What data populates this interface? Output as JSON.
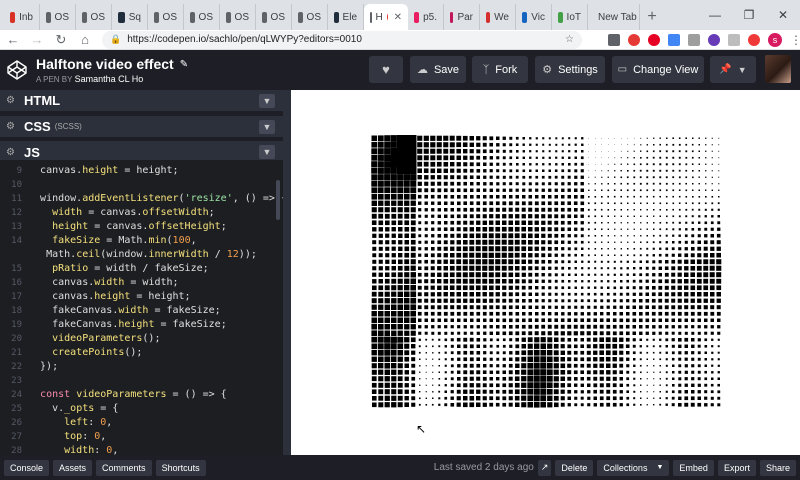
{
  "browser": {
    "tabs": [
      {
        "label": "Inb",
        "icon": "gmail-icon",
        "color": "#d93025"
      },
      {
        "label": "OS",
        "icon": "doc-icon",
        "color": "#5f6368"
      },
      {
        "label": "OS",
        "icon": "doc-icon",
        "color": "#5f6368"
      },
      {
        "label": "Sq",
        "icon": "tuts-icon",
        "color": "#1f2d3d"
      },
      {
        "label": "OS",
        "icon": "doc-icon",
        "color": "#5f6368"
      },
      {
        "label": "OS",
        "icon": "doc-icon",
        "color": "#5f6368"
      },
      {
        "label": "OS",
        "icon": "doc-icon",
        "color": "#5f6368"
      },
      {
        "label": "OS",
        "icon": "doc-icon",
        "color": "#5f6368"
      },
      {
        "label": "OS",
        "icon": "doc-icon",
        "color": "#5f6368"
      },
      {
        "label": "Ele",
        "icon": "tuts-icon",
        "color": "#1f2d3d"
      },
      {
        "label": "H",
        "icon": "doc-icon",
        "color": "#5f6368",
        "active": true
      },
      {
        "label": "p5.",
        "icon": "star-icon",
        "color": "#e91e63"
      },
      {
        "label": "Par",
        "icon": "flag-icon",
        "color": "#c2185b"
      },
      {
        "label": "We",
        "icon": "id-icon",
        "color": "#d32f2f"
      },
      {
        "label": "Vic",
        "icon": "vscode-icon",
        "color": "#1565c0"
      },
      {
        "label": "IoT",
        "icon": "home-icon",
        "color": "#43a047"
      },
      {
        "label": "New Tab",
        "icon": "doc-icon",
        "color": "#5f6368"
      }
    ],
    "url": "https://codepen.io/sachlo/pen/qLWYPy?editors=0010",
    "profile_initial": "s",
    "profile_color": "#d81b60",
    "record_color": "#e53935"
  },
  "header": {
    "title": "Halftone video effect",
    "by_prefix": "A PEN BY",
    "author": "Samantha CL Ho",
    "save_label": "Save",
    "fork_label": "Fork",
    "settings_label": "Settings",
    "change_view_label": "Change View"
  },
  "panels": {
    "html": {
      "label": "HTML",
      "sub": ""
    },
    "css": {
      "label": "CSS",
      "sub": "(SCSS)"
    },
    "js": {
      "label": "JS",
      "sub": ""
    }
  },
  "editor": {
    "lines": [
      {
        "n": "9",
        "t": "  canvas.height = height;"
      },
      {
        "n": "10",
        "t": ""
      },
      {
        "n": "11",
        "t": "  window.addEventListener('resize', () => {"
      },
      {
        "n": "12",
        "t": "    width = canvas.offsetWidth;"
      },
      {
        "n": "13",
        "t": "    height = canvas.offsetHeight;"
      },
      {
        "n": "14",
        "t": "    fakeSize = Math.min(100,"
      },
      {
        "n": "",
        "t": "   Math.ceil(window.innerWidth / 12));"
      },
      {
        "n": "15",
        "t": "    pRatio = width / fakeSize;"
      },
      {
        "n": "16",
        "t": "    canvas.width = width;"
      },
      {
        "n": "17",
        "t": "    canvas.height = height;"
      },
      {
        "n": "18",
        "t": "    fakeCanvas.width = fakeSize;"
      },
      {
        "n": "19",
        "t": "    fakeCanvas.height = fakeSize;"
      },
      {
        "n": "20",
        "t": "    videoParameters();"
      },
      {
        "n": "21",
        "t": "    createPoints();"
      },
      {
        "n": "22",
        "t": "  });"
      },
      {
        "n": "23",
        "t": ""
      },
      {
        "n": "24",
        "t": "  const videoParameters = () => {"
      },
      {
        "n": "25",
        "t": "    v._opts = {"
      },
      {
        "n": "26",
        "t": "      left: 0,"
      },
      {
        "n": "27",
        "t": "      top: 0,"
      },
      {
        "n": "28",
        "t": "      width: 0,"
      }
    ]
  },
  "footer": {
    "console": "Console",
    "assets": "Assets",
    "comments": "Comments",
    "shortcuts": "Shortcuts",
    "last_saved": "Last saved 2 days ago",
    "delete": "Delete",
    "collections": "Collections",
    "embed": "Embed",
    "export": "Export",
    "share": "Share"
  }
}
